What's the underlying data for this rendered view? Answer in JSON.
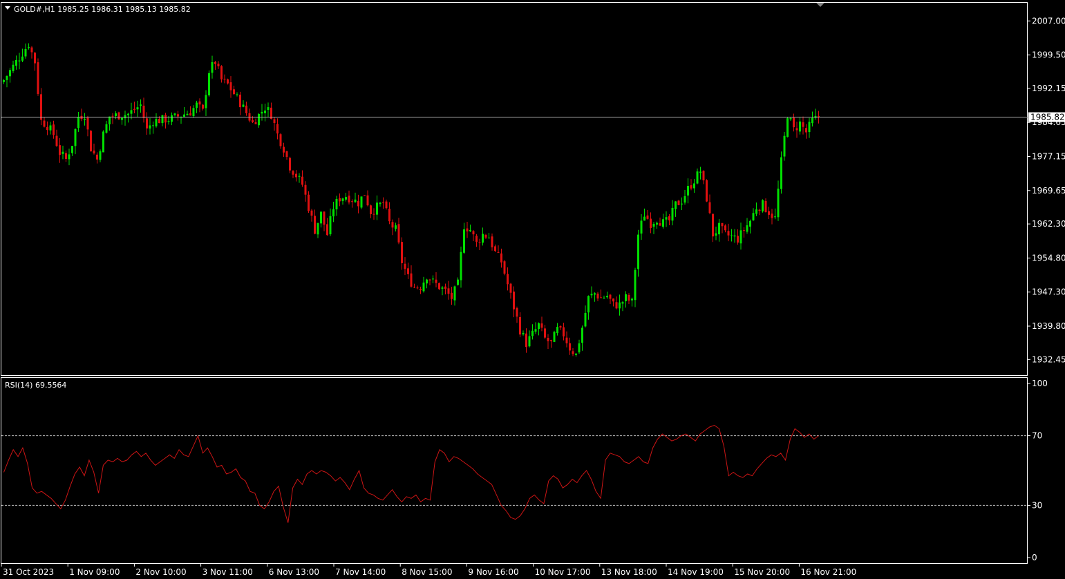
{
  "header": {
    "symbol_line": "GOLD#,H1  1985.25 1986.31 1985.13 1985.82"
  },
  "rsi_header": "RSI(14) 69.5564",
  "colors": {
    "background": "#000000",
    "bull": "#00e000",
    "bear": "#e01010",
    "rsi_line": "#cc1515",
    "frame": "#ffffff",
    "text": "#ffffff"
  },
  "chart_data": [
    {
      "type": "candlestick",
      "symbol": "GOLD#",
      "timeframe": "H1",
      "last_price": 1985.82,
      "last_price_label": "1985.82",
      "ylim": [
        1929.0,
        2011.0
      ],
      "y_ticks": [
        "2007.00",
        "1999.50",
        "1992.15",
        "1984.65",
        "1977.15",
        "1969.65",
        "1962.30",
        "1954.80",
        "1947.30",
        "1939.80",
        "1932.45"
      ],
      "x_ticks": [
        "31 Oct 2023",
        "1 Nov 09:00",
        "2 Nov 10:00",
        "3 Nov 11:00",
        "6 Nov 13:00",
        "7 Nov 14:00",
        "8 Nov 15:00",
        "9 Nov 16:00",
        "10 Nov 17:00",
        "13 Nov 18:00",
        "14 Nov 19:00",
        "15 Nov 20:00",
        "16 Nov 21:00"
      ],
      "close_path": [
        [
          0,
          1994.0
        ],
        [
          5,
          1999.0
        ],
        [
          8,
          2002.0
        ],
        [
          10,
          1998.0
        ],
        [
          12,
          1985.0
        ],
        [
          14,
          1984.0
        ],
        [
          16,
          1982.0
        ],
        [
          18,
          1978.0
        ],
        [
          20,
          1976.5
        ],
        [
          22,
          1980.0
        ],
        [
          24,
          1986.0
        ],
        [
          26,
          1986.5
        ],
        [
          28,
          1979.0
        ],
        [
          30,
          1976.5
        ],
        [
          32,
          1982.0
        ],
        [
          34,
          1986.0
        ],
        [
          40,
          1986.5
        ],
        [
          44,
          1988.5
        ],
        [
          46,
          1983.0
        ],
        [
          48,
          1985.0
        ],
        [
          54,
          1985.5
        ],
        [
          60,
          1987.0
        ],
        [
          62,
          1988.5
        ],
        [
          64,
          1987.0
        ],
        [
          66,
          1996.0
        ],
        [
          68,
          1998.0
        ],
        [
          70,
          1994.0
        ],
        [
          72,
          1993.0
        ],
        [
          74,
          1991.0
        ],
        [
          76,
          1989.0
        ],
        [
          80,
          1984.5
        ],
        [
          84,
          1988.0
        ],
        [
          86,
          1986.5
        ],
        [
          88,
          1982.0
        ],
        [
          90,
          1979.0
        ],
        [
          92,
          1975.0
        ],
        [
          94,
          1973.0
        ],
        [
          96,
          1971.0
        ],
        [
          98,
          1966.0
        ],
        [
          100,
          1961.0
        ],
        [
          102,
          1964.5
        ],
        [
          104,
          1960.0
        ],
        [
          106,
          1966.0
        ],
        [
          108,
          1968.0
        ],
        [
          110,
          1968.5
        ],
        [
          114,
          1967.0
        ],
        [
          116,
          1969.0
        ],
        [
          118,
          1965.0
        ],
        [
          120,
          1966.0
        ],
        [
          122,
          1967.0
        ],
        [
          124,
          1962.5
        ],
        [
          126,
          1961.0
        ],
        [
          128,
          1954.0
        ],
        [
          130,
          1950.5
        ],
        [
          132,
          1948.5
        ],
        [
          134,
          1948.5
        ],
        [
          136,
          1951.0
        ],
        [
          138,
          1949.5
        ],
        [
          140,
          1948.5
        ],
        [
          142,
          1947.5
        ],
        [
          144,
          1946.0
        ],
        [
          146,
          1949.0
        ],
        [
          148,
          1962.0
        ],
        [
          150,
          1961.0
        ],
        [
          152,
          1958.0
        ],
        [
          154,
          1960.0
        ],
        [
          156,
          1959.5
        ],
        [
          158,
          1956.0
        ],
        [
          160,
          1954.0
        ],
        [
          162,
          1949.0
        ],
        [
          164,
          1944.0
        ],
        [
          166,
          1939.0
        ],
        [
          168,
          1936.0
        ],
        [
          170,
          1938.0
        ],
        [
          172,
          1940.0
        ],
        [
          174,
          1937.0
        ],
        [
          176,
          1936.0
        ],
        [
          178,
          1939.0
        ],
        [
          180,
          1938.0
        ],
        [
          182,
          1935.0
        ],
        [
          184,
          1933.5
        ],
        [
          186,
          1939.5
        ],
        [
          188,
          1946.0
        ],
        [
          190,
          1947.0
        ],
        [
          192,
          1946.0
        ],
        [
          194,
          1946.5
        ],
        [
          196,
          1944.5
        ],
        [
          198,
          1944.5
        ],
        [
          200,
          1946.0
        ],
        [
          202,
          1945.0
        ],
        [
          204,
          1960.0
        ],
        [
          206,
          1964.5
        ],
        [
          208,
          1962.5
        ],
        [
          210,
          1963.5
        ],
        [
          212,
          1962.5
        ],
        [
          214,
          1963.0
        ],
        [
          216,
          1966.5
        ],
        [
          218,
          1967.5
        ],
        [
          220,
          1970.0
        ],
        [
          222,
          1972.0
        ],
        [
          224,
          1974.0
        ],
        [
          226,
          1968.0
        ],
        [
          228,
          1960.0
        ],
        [
          230,
          1961.5
        ],
        [
          232,
          1960.0
        ],
        [
          234,
          1959.5
        ],
        [
          236,
          1959.0
        ],
        [
          238,
          1961.0
        ],
        [
          240,
          1963.0
        ],
        [
          242,
          1966.0
        ],
        [
          244,
          1966.5
        ],
        [
          246,
          1965.0
        ],
        [
          248,
          1963.5
        ],
        [
          250,
          1976.0
        ],
        [
          252,
          1986.5
        ],
        [
          254,
          1983.0
        ],
        [
          256,
          1984.5
        ],
        [
          258,
          1982.5
        ],
        [
          260,
          1985.0
        ],
        [
          262,
          1985.82
        ]
      ]
    },
    {
      "type": "line",
      "name": "RSI(14)",
      "current": 69.5564,
      "ylim": [
        0,
        100
      ],
      "y_ticks": [
        "100",
        "70",
        "30",
        "0"
      ],
      "levels": [
        70,
        30
      ],
      "series": [
        {
          "name": "RSI(14)",
          "values": [
            49,
            56,
            62,
            58,
            63,
            54,
            40,
            37,
            38,
            36,
            34,
            31,
            28,
            33,
            41,
            48,
            52,
            47,
            56,
            49,
            37,
            53,
            56,
            55,
            57,
            55,
            56,
            59,
            61,
            58,
            60,
            56,
            53,
            55,
            57,
            59,
            57,
            62,
            59,
            58,
            64,
            70,
            60,
            63,
            58,
            52,
            53,
            48,
            49,
            51,
            46,
            44,
            38,
            37,
            30,
            28,
            32,
            38,
            41,
            29,
            20,
            40,
            45,
            42,
            48,
            50,
            48,
            50,
            49,
            47,
            44,
            46,
            43,
            39,
            45,
            50,
            40,
            37,
            36,
            34,
            33,
            36,
            39,
            35,
            32,
            35,
            34,
            36,
            32,
            34,
            33,
            55,
            62,
            60,
            55,
            58,
            57,
            55,
            53,
            51,
            48,
            46,
            44,
            42,
            36,
            30,
            27,
            23,
            22,
            24,
            28,
            34,
            36,
            33,
            31,
            44,
            47,
            45,
            40,
            42,
            45,
            43,
            47,
            50,
            45,
            38,
            34,
            56,
            60,
            59,
            58,
            55,
            54,
            56,
            58,
            55,
            54,
            63,
            68,
            71,
            69,
            67,
            68,
            70,
            71,
            69,
            67,
            71,
            73,
            75,
            76,
            74,
            64,
            47,
            49,
            47,
            46,
            48,
            47,
            51,
            54,
            57,
            59,
            58,
            60,
            56,
            68,
            74,
            72,
            69,
            71,
            68,
            70
          ]
        }
      ]
    }
  ]
}
